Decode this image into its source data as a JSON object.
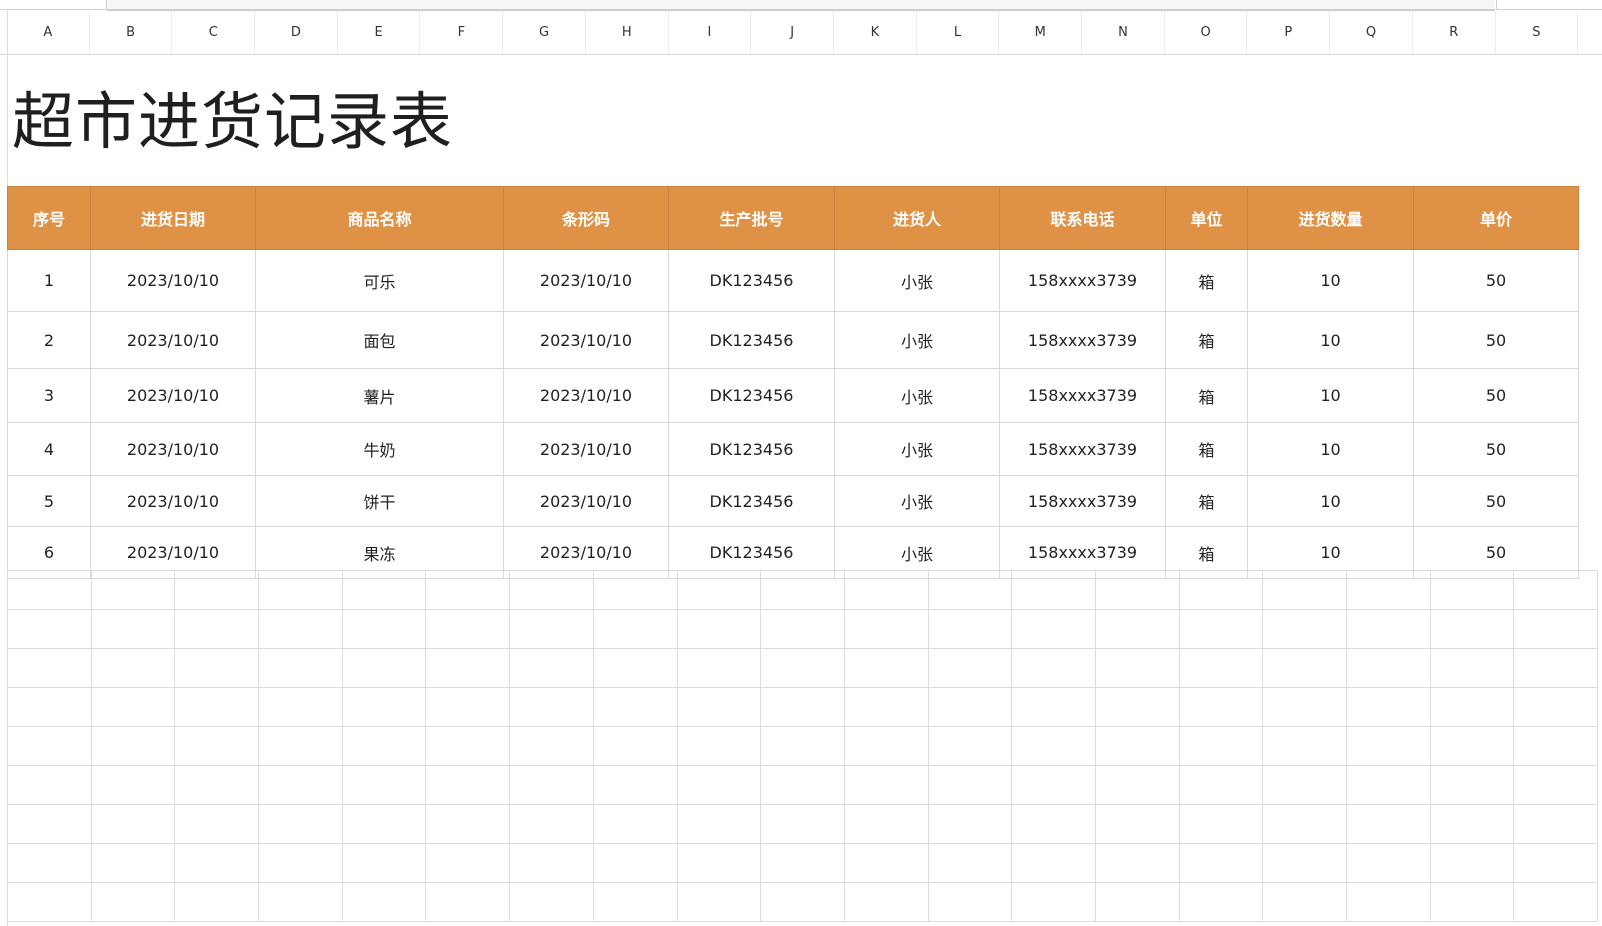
{
  "sheet": {
    "columns": [
      "A",
      "B",
      "C",
      "D",
      "E",
      "F",
      "G",
      "H",
      "I",
      "J",
      "K",
      "L",
      "M",
      "N",
      "O",
      "P",
      "Q",
      "R",
      "S"
    ],
    "title": "超市进货记录表",
    "table": {
      "headers": [
        "序号",
        "进货日期",
        "商品名称",
        "条形码",
        "生产批号",
        "进货人",
        "联系电话",
        "单位",
        "进货数量",
        "单价"
      ],
      "rows": [
        [
          "1",
          "2023/10/10",
          "可乐",
          "2023/10/10",
          "DK123456",
          "小张",
          "158xxxx3739",
          "箱",
          "10",
          "50"
        ],
        [
          "2",
          "2023/10/10",
          "面包",
          "2023/10/10",
          "DK123456",
          "小张",
          "158xxxx3739",
          "箱",
          "10",
          "50"
        ],
        [
          "3",
          "2023/10/10",
          "薯片",
          "2023/10/10",
          "DK123456",
          "小张",
          "158xxxx3739",
          "箱",
          "10",
          "50"
        ],
        [
          "4",
          "2023/10/10",
          "牛奶",
          "2023/10/10",
          "DK123456",
          "小张",
          "158xxxx3739",
          "箱",
          "10",
          "50"
        ],
        [
          "5",
          "2023/10/10",
          "饼干",
          "2023/10/10",
          "DK123456",
          "小张",
          "158xxxx3739",
          "箱",
          "10",
          "50"
        ],
        [
          "6",
          "2023/10/10",
          "果冻",
          "2023/10/10",
          "DK123456",
          "小张",
          "158xxxx3739",
          "箱",
          "10",
          "50"
        ]
      ]
    },
    "header_color": "#df9246"
  }
}
